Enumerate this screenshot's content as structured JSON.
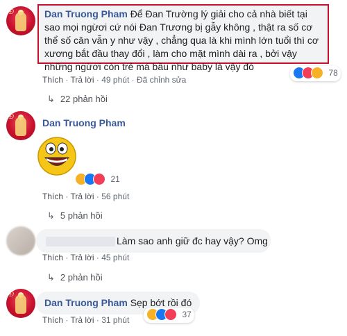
{
  "comments": [
    {
      "author": "Dan Truong Pham",
      "text": "Để Đan Trường lý giải cho cả nhà biết tại sao mọi ngừơi cứ nói Đan Trương bị gẫy không , thật ra số cơ thể số cân vẫn y như vậy , chẳng qua là khi mình lớn tuổi thì cơ xương bắt đầu thay đổi , làm cho mặt mình dài ra , bởi vậy những ngừơi còn trẻ má bầu như baby là vậy đó",
      "like_label": "Thích",
      "reply_label": "Trả lời",
      "time": "49 phút",
      "edited": "Đã chỉnh sửa",
      "reaction_count": "78",
      "replies": "22 phản hồi"
    },
    {
      "author": "Dan Truong Pham",
      "sticker": "grinning-face-sticker",
      "like_label": "Thích",
      "reply_label": "Trả lời",
      "time": "56 phút",
      "reaction_count": "21",
      "replies": "5 phản hồi"
    },
    {
      "text": "Làm sao anh giữ đc hay vậy? Omg",
      "like_label": "Thích",
      "reply_label": "Trả lời",
      "time": "45 phút",
      "replies": "2 phản hồi"
    },
    {
      "author": "Dan Truong Pham",
      "text": "Sẹp bớt rồi đó",
      "like_label": "Thích",
      "reply_label": "Trả lời",
      "time": "31 phút",
      "reaction_count": "37"
    }
  ],
  "colors": {
    "author": "#385898",
    "highlight_border": "#c8102e",
    "like": "#1877f2",
    "love": "#f33e58",
    "haha": "#f7b125"
  }
}
